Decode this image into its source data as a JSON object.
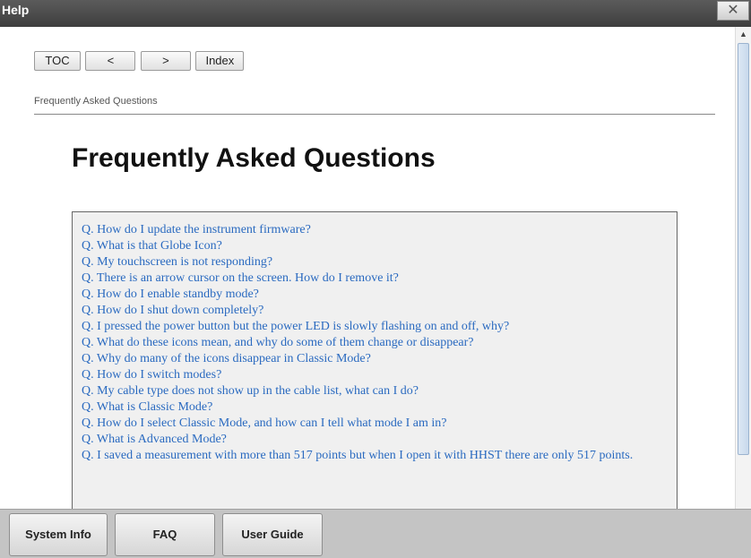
{
  "window": {
    "title": "Help",
    "close_label": "✕"
  },
  "nav": {
    "toc": "TOC",
    "prev": "<",
    "next": ">",
    "index": "Index"
  },
  "breadcrumb": "Frequently Asked Questions",
  "page_title": "Frequently Asked Questions",
  "faq_items": [
    "Q. How do I update the instrument firmware?",
    "Q. What is that Globe Icon?",
    "Q. My touchscreen is not responding?",
    "Q. There is an arrow cursor on the screen. How do I remove it?",
    "Q. How do I enable standby mode?",
    "Q. How do I shut down completely?",
    "Q. I pressed the power button but the power LED is slowly flashing on and off, why?",
    "Q. What do these icons mean, and why do some of them change or disappear?",
    "Q. Why do many of the icons disappear in Classic Mode?",
    "Q. How do I switch modes?",
    "Q. My cable type does not show up in the cable list, what can I do?",
    "Q. What is Classic Mode?",
    "Q. How do I select Classic Mode, and how can I tell what mode I am in?",
    "Q. What is Advanced Mode?",
    "Q. I saved a measurement with more than 517 points but when I open it with HHST there are only 517 points."
  ],
  "scrollbar": {
    "up_arrow": "▲"
  },
  "bottom_buttons": {
    "system_info": "System Info",
    "faq": "FAQ",
    "user_guide": "User Guide"
  }
}
